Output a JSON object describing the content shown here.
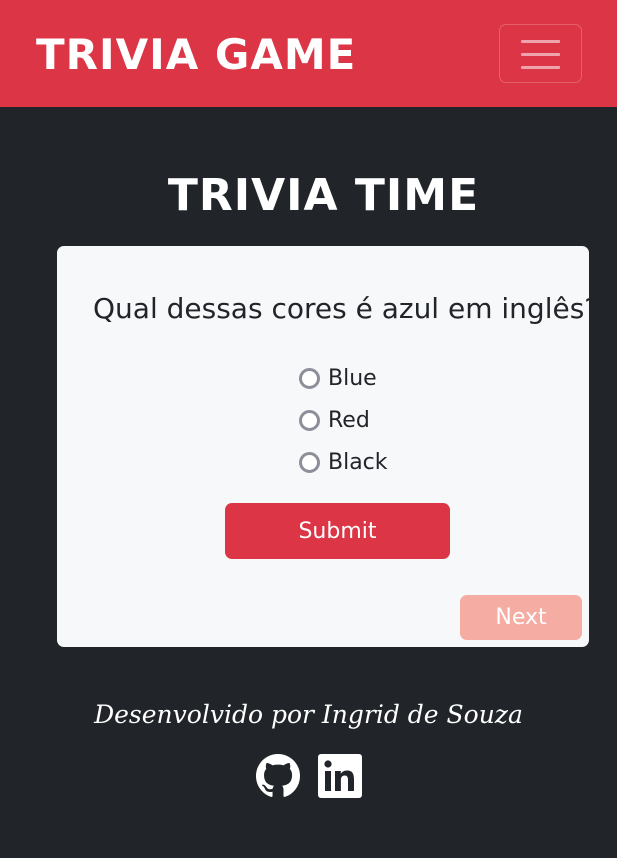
{
  "navbar": {
    "brand": "TRIVIA GAME",
    "toggle_icon": "hamburger-icon",
    "color": "#dc3545"
  },
  "main": {
    "title": "TRIVIA TIME",
    "question": "Qual dessas cores é azul em inglês?",
    "options": [
      {
        "label": "Blue"
      },
      {
        "label": "Red"
      },
      {
        "label": "Black"
      }
    ],
    "submit_label": "Submit",
    "next_label": "Next"
  },
  "footer": {
    "text": "Desenvolvido por Ingrid de Souza",
    "icons": [
      "github-icon",
      "linkedin-icon"
    ]
  },
  "colors": {
    "background": "#212529",
    "card": "#f7f8fa",
    "accent": "#dc3545",
    "next_button": "#f5aca3"
  }
}
